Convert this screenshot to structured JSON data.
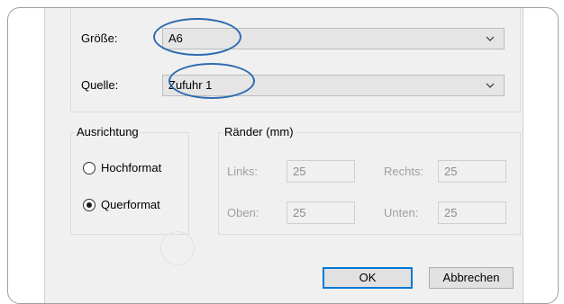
{
  "paper": {
    "size_label": "Größe:",
    "size_value": "A6",
    "source_label": "Quelle:",
    "source_value": "Zufuhr 1"
  },
  "orientation": {
    "title": "Ausrichtung",
    "portrait_label": "Hochformat",
    "landscape_label": "Querformat",
    "selected": "Querformat"
  },
  "margins": {
    "title": "Ränder (mm)",
    "left_label": "Links:",
    "left_value": "25",
    "right_label": "Rechts:",
    "right_value": "25",
    "top_label": "Oben:",
    "top_value": "25",
    "bottom_label": "Unten:",
    "bottom_value": "25"
  },
  "buttons": {
    "ok_label": "OK",
    "cancel_label": "Abbrechen"
  },
  "icons": {
    "dropdown": "chevron-down-icon"
  },
  "colors": {
    "highlight": "#2d6bb0",
    "default_button_border": "#0078d7"
  }
}
